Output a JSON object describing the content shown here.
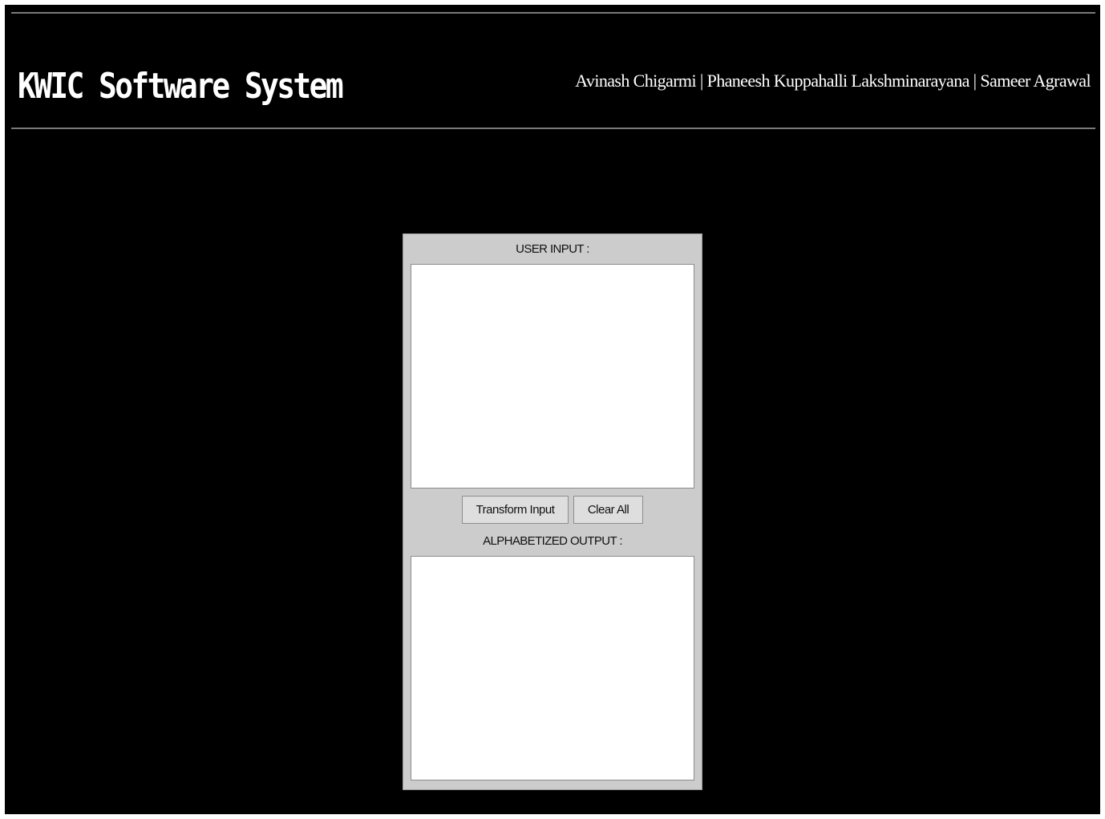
{
  "header": {
    "title": "KWIC Software System",
    "authors": "Avinash Chigarmi | Phaneesh Kuppahalli Lakshminarayana | Sameer Agrawal"
  },
  "form": {
    "input_label": "USER INPUT :",
    "input_value": "",
    "transform_button": "Transform Input",
    "clear_button": "Clear All",
    "output_label": "ALPHABETIZED OUTPUT :",
    "output_value": ""
  },
  "colors": {
    "background": "#000000",
    "panel": "#cccccc",
    "rule": "#7a7a7a",
    "text_header": "#ffffff"
  }
}
